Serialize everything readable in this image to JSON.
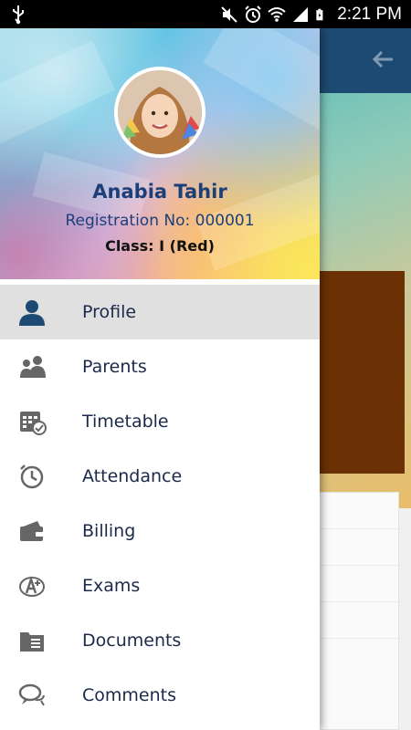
{
  "status_bar": {
    "time": "2:21 PM"
  },
  "drawer": {
    "user": {
      "name": "Anabia Tahir",
      "registration_label": "Registration No:",
      "registration_no": "000001",
      "class_label": "Class:",
      "class_value": "I (Red)"
    },
    "menu": [
      {
        "label": "Profile",
        "icon": "person-icon",
        "active": true
      },
      {
        "label": "Parents",
        "icon": "parents-icon",
        "active": false
      },
      {
        "label": "Timetable",
        "icon": "timetable-icon",
        "active": false
      },
      {
        "label": "Attendance",
        "icon": "clock-icon",
        "active": false
      },
      {
        "label": "Billing",
        "icon": "wallet-icon",
        "active": false
      },
      {
        "label": "Exams",
        "icon": "grade-icon",
        "active": false
      },
      {
        "label": "Documents",
        "icon": "folder-icon",
        "active": false
      },
      {
        "label": "Comments",
        "icon": "comments-icon",
        "active": false
      }
    ]
  },
  "colors": {
    "toolbar": "#1d4a72",
    "active_item_bg": "#e0e0e0",
    "name_text": "#1c3f7a",
    "active_icon": "#1d4a72",
    "inactive_icon": "#666666"
  }
}
